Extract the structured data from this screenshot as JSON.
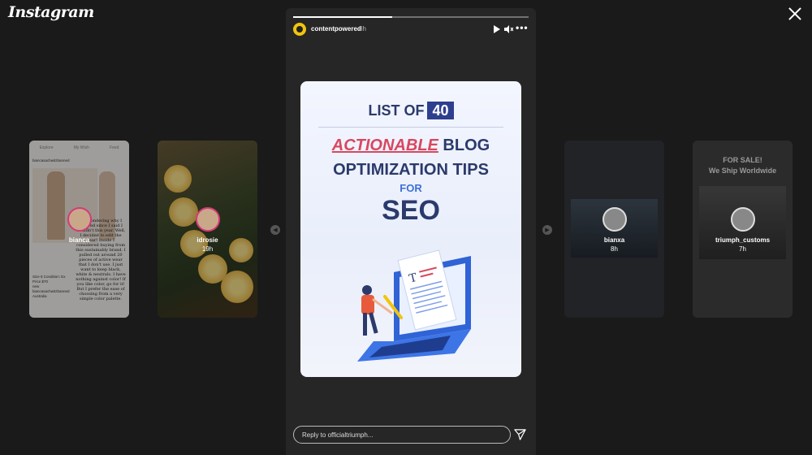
{
  "app": {
    "logo": "Instagram"
  },
  "main_story": {
    "username": "contentpowered",
    "time": "8h",
    "progress": 0.42,
    "card": {
      "line1": "LIST OF",
      "number": "40",
      "highlight": "ACTIONABLE",
      "line2_rest": " BLOG",
      "line3": "OPTIMIZATION TIPS",
      "line4": "FOR",
      "line5": "SEO"
    },
    "reply_placeholder": "Reply to officialtriumph..."
  },
  "side_stories": [
    {
      "username": "bianca",
      "time": ""
    },
    {
      "username": "idrosie",
      "time": "19h"
    },
    {
      "username": "bianxa",
      "time": "8h"
    },
    {
      "username": "triumph_customs",
      "time": "7h"
    }
  ],
  "card1": {
    "tabs": [
      "Explore",
      "My Wish",
      "Feed"
    ],
    "user": "biancasachwitzbanned",
    "caption": "I'm wondering why I stopped since I said I wouldn't this year. Well, I decided to edit the year! Inside I considered buying from this sustainably brand. I pulled out around 20 pieces of active wear that I don't use. I just want to keep black, white & neutrals. I have nothing against color! If you like color, go for it! But I prefer the ease of choosing from a very simple color palette.",
    "size": "Size 8",
    "condition": "Condition: Ex",
    "price": "Price $70",
    "new": "new",
    "user2": "biancasachwitzbanned",
    "location": "Australia"
  },
  "card4": {
    "title_line1": "FOR SALE!",
    "title_line2": "We Ship Worldwide"
  },
  "icons": {
    "close": "close-icon",
    "play": "play-icon",
    "mute": "volume-icon",
    "more": "more-icon",
    "send": "send-icon",
    "prev": "chevron-left-icon",
    "next": "chevron-right-icon"
  },
  "colors": {
    "background": "#1a1a1a",
    "story_bg": "#262626",
    "accent_red": "#d9475f",
    "navy": "#2b3a6b",
    "blue": "#3d6fd6"
  }
}
